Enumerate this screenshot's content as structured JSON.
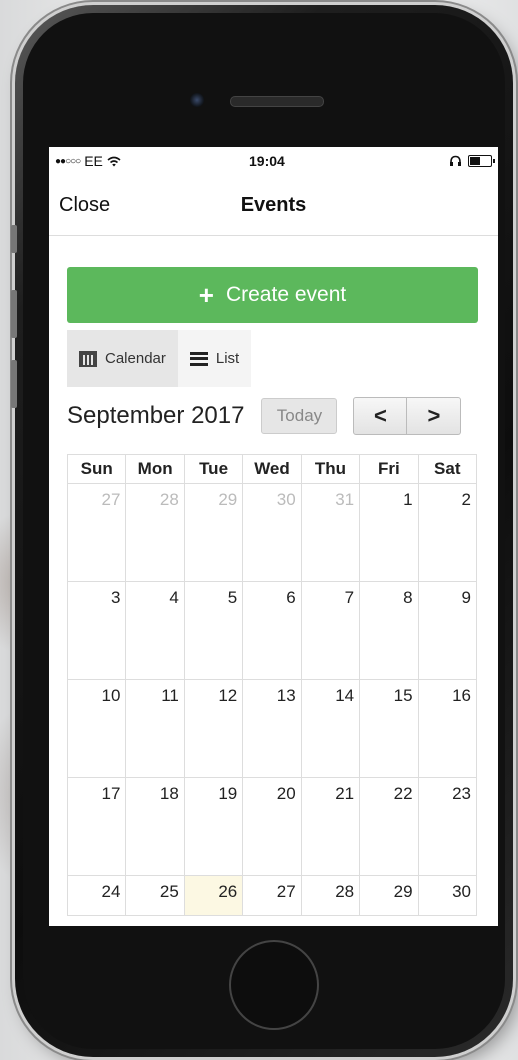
{
  "status_bar": {
    "signal_dots": "●●○○○",
    "carrier": "EE",
    "wifi_icon": "wifi-icon",
    "time": "19:04",
    "headphones_icon": "headphones-icon",
    "battery_icon": "battery-icon"
  },
  "navbar": {
    "close_label": "Close",
    "title": "Events"
  },
  "create_button": {
    "icon": "plus-icon",
    "label": "Create event",
    "color": "#5cb85c"
  },
  "view_tabs": [
    {
      "label": "Calendar",
      "icon": "calendar-icon",
      "active": true
    },
    {
      "label": "List",
      "icon": "list-icon",
      "active": false
    }
  ],
  "calendar_header": {
    "month_title": "September 2017",
    "today_label": "Today",
    "prev_label": "<",
    "next_label": ">"
  },
  "calendar": {
    "weekdays": [
      "Sun",
      "Mon",
      "Tue",
      "Wed",
      "Thu",
      "Fri",
      "Sat"
    ],
    "weeks": [
      [
        {
          "d": "27",
          "other": true
        },
        {
          "d": "28",
          "other": true
        },
        {
          "d": "29",
          "other": true
        },
        {
          "d": "30",
          "other": true
        },
        {
          "d": "31",
          "other": true
        },
        {
          "d": "1"
        },
        {
          "d": "2"
        }
      ],
      [
        {
          "d": "3"
        },
        {
          "d": "4"
        },
        {
          "d": "5"
        },
        {
          "d": "6"
        },
        {
          "d": "7"
        },
        {
          "d": "8"
        },
        {
          "d": "9"
        }
      ],
      [
        {
          "d": "10"
        },
        {
          "d": "11"
        },
        {
          "d": "12"
        },
        {
          "d": "13"
        },
        {
          "d": "14"
        },
        {
          "d": "15"
        },
        {
          "d": "16"
        }
      ],
      [
        {
          "d": "17"
        },
        {
          "d": "18"
        },
        {
          "d": "19"
        },
        {
          "d": "20"
        },
        {
          "d": "21"
        },
        {
          "d": "22"
        },
        {
          "d": "23"
        }
      ],
      [
        {
          "d": "24"
        },
        {
          "d": "25"
        },
        {
          "d": "26",
          "today": true
        },
        {
          "d": "27"
        },
        {
          "d": "28"
        },
        {
          "d": "29"
        },
        {
          "d": "30"
        }
      ]
    ],
    "today_highlight_color": "#fcf8e3"
  }
}
